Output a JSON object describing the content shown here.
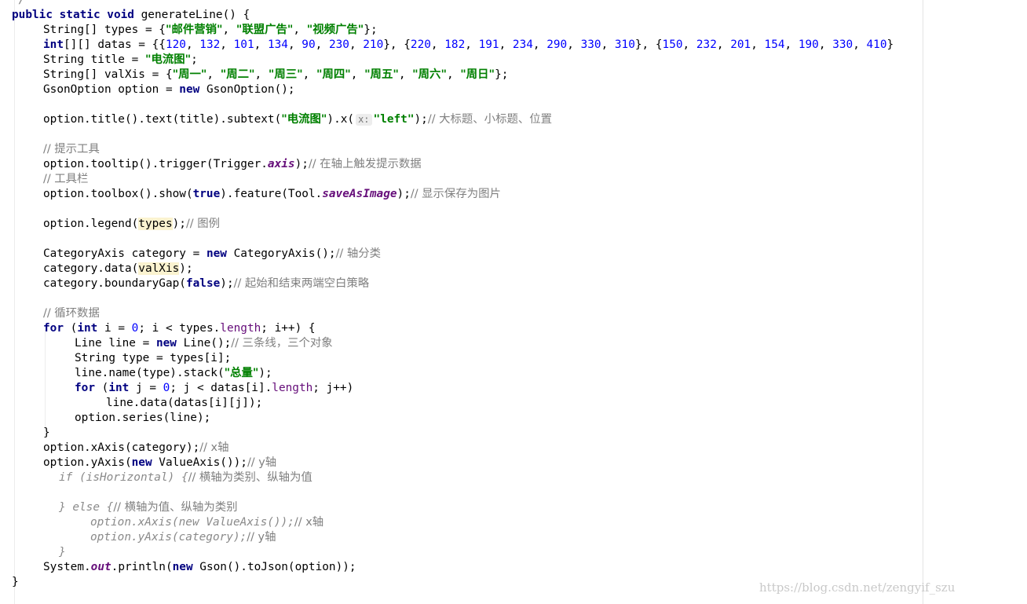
{
  "code": {
    "l0": "*/",
    "l1_kw": "public static void",
    "l1_rest": " generateLine() {",
    "l2_a": "String[] types = {",
    "l2_s1": "\"邮件营销\"",
    "l2_s2": "\"联盟广告\"",
    "l2_s3": "\"视频广告\"",
    "l2_end": "};",
    "l3_kw": "int",
    "l3_a": "[][] datas = {{",
    "datas_1": [
      "120",
      "132",
      "101",
      "134",
      "90",
      "230",
      "210"
    ],
    "datas_2": [
      "220",
      "182",
      "191",
      "234",
      "290",
      "330",
      "310"
    ],
    "datas_3": [
      "150",
      "232",
      "201",
      "154",
      "190",
      "330",
      "410"
    ],
    "l4_a": "String title = ",
    "l4_s": "\"电流图\"",
    "l4_end": ";",
    "l5_a": "String[] valXis = {",
    "l5_days": [
      "\"周一\"",
      "\"周二\"",
      "\"周三\"",
      "\"周四\"",
      "\"周五\"",
      "\"周六\"",
      "\"周日\""
    ],
    "l5_end": "};",
    "l6_a": "GsonOption option = ",
    "l6_kw": "new",
    "l6_b": " GsonOption();",
    "l8_a": "option.title().text(title).subtext(",
    "l8_s": "\"电流图\"",
    "l8_b": ").x(",
    "l8_hint": "x:",
    "l8_s2": "\"left\"",
    "l8_c": ");",
    "l8_cmt": "// 大标题、小标题、位置",
    "l10_cmt": "// 提示工具",
    "l11_a": "option.tooltip().trigger(Trigger.",
    "l11_f": "axis",
    "l11_b": ");",
    "l11_cmt": "// 在轴上触发提示数据",
    "l12_cmt": "// 工具栏",
    "l13_a": "option.toolbox().show(",
    "l13_kw": "true",
    "l13_b": ").feature(Tool.",
    "l13_f": "saveAsImage",
    "l13_c": ");",
    "l13_cmt": "// 显示保存为图片",
    "l15_a": "option.legend(",
    "l15_hl": "types",
    "l15_b": ");",
    "l15_cmt": "// 图例",
    "l17_a": "CategoryAxis category = ",
    "l17_kw": "new",
    "l17_b": " CategoryAxis();",
    "l17_cmt": "// 轴分类",
    "l18_a": "category.data(",
    "l18_hl": "valXis",
    "l18_b": ");",
    "l19_a": "category.boundaryGap(",
    "l19_kw": "false",
    "l19_b": ");",
    "l19_cmt": "// 起始和结束两端空白策略",
    "l21_cmt": "// 循环数据",
    "l22_kw1": "for",
    "l22_a": " (",
    "l22_kw2": "int",
    "l22_b": " i = ",
    "l22_n": "0",
    "l22_c": "; i < types.",
    "l22_f": "length",
    "l22_d": "; i++) {",
    "l23_a": "Line line = ",
    "l23_kw": "new",
    "l23_b": " Line();",
    "l23_cmt": "// 三条线，三个对象",
    "l24_a": "String type = types[i];",
    "l25_a": "line.name(type).stack(",
    "l25_s": "\"总量\"",
    "l25_b": ");",
    "l26_kw1": "for",
    "l26_a": " (",
    "l26_kw2": "int",
    "l26_b": " j = ",
    "l26_n": "0",
    "l26_c": "; j < datas[i].",
    "l26_f": "length",
    "l26_d": "; j++)",
    "l27_a": "line.data(datas[i][j]);",
    "l28_a": "option.series(line);",
    "l29_a": "}",
    "l30_a": "option.xAxis(category);",
    "l30_cmt": "// x轴",
    "l31_a": "option.yAxis(",
    "l31_kw": "new",
    "l31_b": " ValueAxis());",
    "l31_cmt": "// y轴",
    "l32_a": "if (isHorizontal) {",
    "l32_cmt": "// 横轴为类别、纵轴为值",
    "l34_a": "} else {",
    "l34_cmt": "// 横轴为值、纵轴为类别",
    "l35_a": "option.xAxis(new ValueAxis());",
    "l35_cmt": "// x轴",
    "l36_a": "option.yAxis(category);",
    "l36_cmt": "// y轴",
    "l37_a": "}",
    "l38_a": "System.",
    "l38_f": "out",
    "l38_b": ".println(",
    "l38_kw": "new",
    "l38_c": " Gson().toJson(option));",
    "l39_a": "}"
  },
  "watermark": "https://blog.csdn.net/zengyif_szu"
}
